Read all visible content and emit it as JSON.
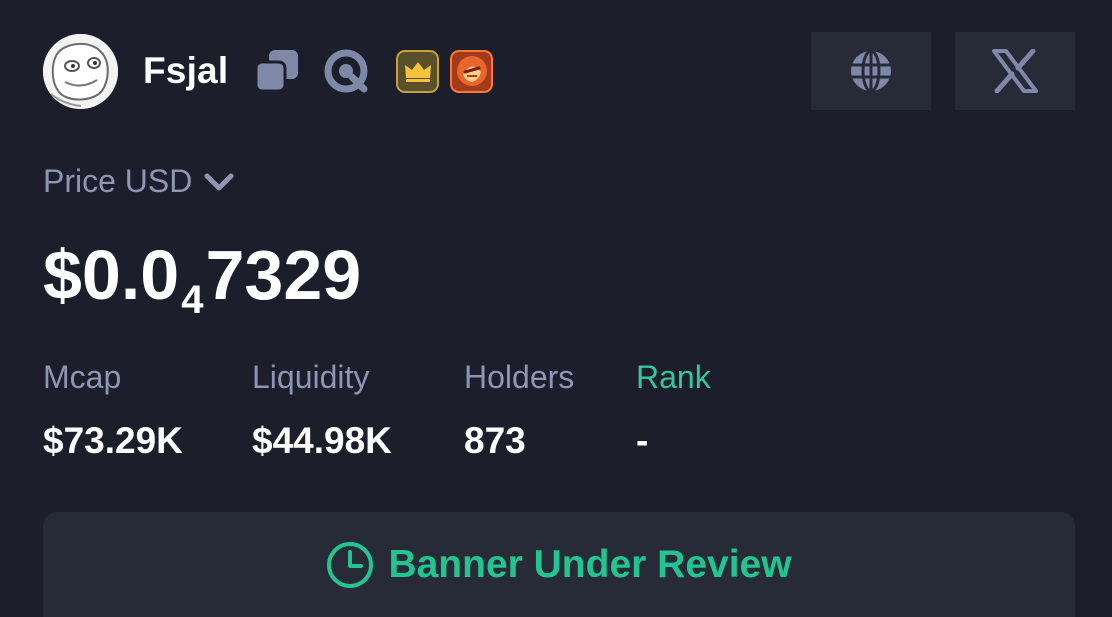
{
  "token": {
    "name": "Fsjal"
  },
  "price": {
    "label": "Price USD",
    "prefix": "$0.0",
    "subscript": "4",
    "suffix": "7329"
  },
  "stats": [
    {
      "label": "Mcap",
      "value": "$73.29K"
    },
    {
      "label": "Liquidity",
      "value": "$44.98K"
    },
    {
      "label": "Holders",
      "value": "873"
    },
    {
      "label": "Rank",
      "value": "-"
    }
  ],
  "banner": {
    "text": "Banner Under Review"
  },
  "icons": {
    "copy": "copy-icon",
    "scan": "scan-icon",
    "crown_badge": "crown-icon",
    "fire_badge": "fire-badge-icon",
    "website": "globe-icon",
    "social": "x-icon",
    "dropdown": "chevron-down-icon",
    "banner": "clock-icon"
  },
  "colors": {
    "background": "#1c1f2b",
    "panel": "#272a37",
    "muted_text": "#8f95b4",
    "accent": "#22c58f"
  }
}
